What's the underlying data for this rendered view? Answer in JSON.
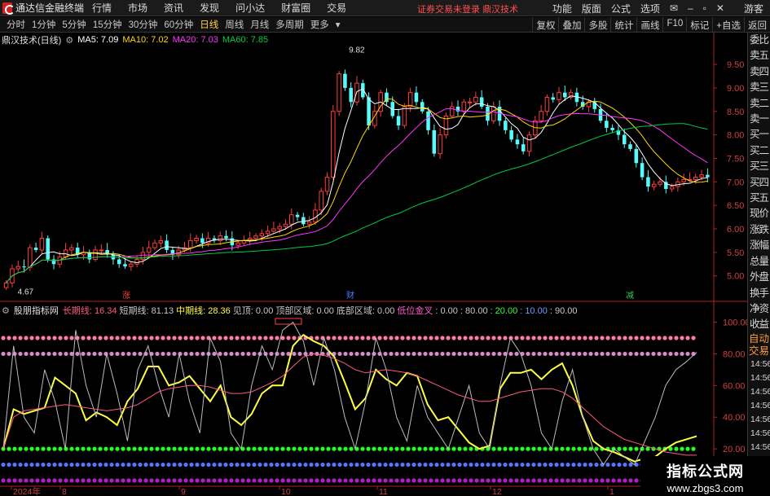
{
  "app": {
    "title": "通达信金融终端"
  },
  "menu": {
    "items": [
      "行情",
      "市场",
      "资讯",
      "发现",
      "问小达",
      "财富圈",
      "交易"
    ],
    "notice_warn": "证券交易未登录",
    "notice_stock": "鼎汉技术",
    "right_items": [
      "功能",
      "版面",
      "公式",
      "选项"
    ],
    "guest": "游客"
  },
  "toolbar": {
    "periods": [
      "分时",
      "1分钟",
      "5分钟",
      "15分钟",
      "30分钟",
      "60分钟",
      "日线",
      "周线",
      "月线",
      "多周期",
      "更多"
    ],
    "active_period": "日线",
    "tools": [
      "复权",
      "叠加",
      "多股",
      "统计",
      "画线",
      "F10",
      "标记",
      "+自选",
      "返回"
    ]
  },
  "main_indicator": {
    "stock_label": "鼎汉技术(日线)",
    "ma5": "MA5: 7.09",
    "ma10": "MA10: 7.02",
    "ma20": "MA20: 7.03",
    "ma60": "MA60: 7.85",
    "colors": {
      "ma5": "#ffffff",
      "ma10": "#ffd700",
      "ma20": "#ff33ff",
      "ma60": "#00cc44"
    }
  },
  "sub_indicator": {
    "name": "股朋指标网",
    "items": [
      {
        "text": "长期线: 16.34",
        "color": "#ff5a7a"
      },
      {
        "text": "短期线: 81.13",
        "color": "#c8c8c8"
      },
      {
        "text": "中期线: 28.36",
        "color": "#ffff44"
      },
      {
        "text": "见顶: 0.00",
        "color": "#c8c8c8"
      },
      {
        "text": "顶部区域: 0.00",
        "color": "#c8c8c8"
      },
      {
        "text": "底部区域: 0.00",
        "color": "#c8c8c8"
      },
      {
        "text": "低位金叉",
        "color": "#ff55cc"
      },
      {
        "text": ": 0.00",
        "color": "#c8c8c8"
      },
      {
        "text": ": 80.00",
        "color": "#c8c8c8"
      },
      {
        "text": ": 20.00",
        "color": "#33ff33"
      },
      {
        "text": ": 10.00",
        "color": "#6f9bff"
      },
      {
        "text": ": 90.00",
        "color": "#c8c8c8"
      }
    ]
  },
  "side_labels": {
    "top": [
      "委比",
      "卖五",
      "卖四",
      "卖三",
      "卖二",
      "卖一",
      "买一",
      "买二",
      "买三",
      "买四",
      "买五",
      "现价",
      "涨跌",
      "涨幅",
      "总量",
      "外盘",
      "换手",
      "净资",
      "收益"
    ],
    "orange": [
      "自动",
      "交易"
    ],
    "times": [
      "14:56",
      "14:56",
      "14:56",
      "14:56",
      "14:56",
      "14:56",
      "14:56",
      "14:56",
      "14:56",
      "14:56"
    ]
  },
  "watermark": {
    "line1": "指标公式网",
    "line2": "www.zbgs3.com"
  },
  "chart_data": [
    {
      "type": "candlestick",
      "title": "鼎汉技术(日线)",
      "ylim": [
        4.7,
        9.9
      ],
      "y_ticks": [
        5.0,
        5.5,
        6.0,
        6.5,
        7.0,
        7.5,
        8.0,
        8.5,
        9.0,
        9.5
      ],
      "annotations": [
        {
          "text": "9.82"
        },
        {
          "text": "4.67"
        }
      ],
      "event_markers": [
        {
          "text": "涨",
          "color": "#ff4040"
        },
        {
          "text": "财",
          "color": "#4a7dff"
        },
        {
          "text": "减",
          "color": "#33cc55"
        }
      ],
      "x_labels": [
        "2024年",
        "8",
        "9",
        "10",
        "11",
        "12",
        "1"
      ],
      "closes": [
        4.85,
        5.15,
        5.2,
        5.18,
        5.6,
        5.55,
        5.8,
        5.35,
        5.25,
        5.4,
        5.55,
        5.6,
        5.45,
        5.5,
        5.35,
        5.55,
        5.55,
        5.45,
        5.35,
        5.25,
        5.2,
        5.25,
        5.35,
        5.5,
        5.6,
        5.7,
        5.75,
        5.55,
        5.45,
        5.55,
        5.6,
        5.75,
        5.8,
        5.7,
        5.8,
        5.75,
        5.85,
        5.8,
        5.65,
        5.7,
        5.75,
        5.8,
        5.85,
        5.9,
        5.95,
        6.0,
        6.05,
        6.1,
        6.3,
        6.25,
        6.1,
        6.15,
        6.4,
        6.8,
        7.1,
        8.5,
        9.3,
        9.0,
        8.7,
        9.1,
        8.8,
        8.2,
        8.5,
        8.9,
        8.7,
        8.4,
        8.2,
        8.6,
        8.9,
        8.7,
        8.5,
        8.1,
        7.6,
        8.0,
        8.4,
        8.6,
        8.5,
        8.7,
        8.7,
        8.8,
        8.6,
        8.3,
        8.6,
        8.3,
        8.1,
        7.9,
        7.8,
        7.65,
        8.0,
        8.3,
        8.5,
        8.8,
        8.75,
        8.9,
        8.8,
        8.9,
        8.7,
        8.6,
        8.7,
        8.55,
        8.3,
        8.15,
        8.1,
        8.0,
        7.8,
        7.7,
        7.4,
        7.1,
        6.9,
        6.95,
        7.0,
        6.85,
        6.9,
        7.0,
        7.05,
        7.05,
        7.1,
        7.15,
        7.1
      ],
      "series": [
        {
          "name": "MA5",
          "color": "#ffffff"
        },
        {
          "name": "MA10",
          "color": "#ffd700"
        },
        {
          "name": "MA20",
          "color": "#ff33ff"
        },
        {
          "name": "MA60",
          "color": "#00cc44"
        }
      ]
    },
    {
      "type": "line",
      "title": "股朋指标网",
      "ylim": [
        0,
        108
      ],
      "y_ticks": [
        20.0,
        40.0,
        60.0,
        80.0,
        100.0
      ],
      "series": [
        {
          "name": "中期线",
          "color": "#ffff44",
          "values": [
            20,
            45,
            42,
            44,
            46,
            65,
            60,
            55,
            38,
            43,
            40,
            35,
            50,
            58,
            72,
            72,
            60,
            62,
            66,
            58,
            50,
            60,
            40,
            35,
            42,
            55,
            60,
            60,
            85,
            92,
            88,
            85,
            78,
            62,
            45,
            52,
            70,
            64,
            60,
            68,
            66,
            48,
            38,
            40,
            32,
            24,
            20,
            22,
            58,
            68,
            68,
            70,
            64,
            70,
            74,
            60,
            40,
            25,
            20,
            18,
            15,
            12,
            14,
            15,
            20,
            24,
            26,
            28
          ]
        },
        {
          "name": "短期线",
          "color": "#bbbbbb",
          "values": [
            20,
            85,
            40,
            30,
            70,
            50,
            20,
            95,
            60,
            40,
            80,
            55,
            25,
            70,
            85,
            60,
            40,
            80,
            50,
            30,
            90,
            75,
            30,
            20,
            60,
            85,
            70,
            95,
            100,
            88,
            60,
            90,
            70,
            40,
            20,
            50,
            90,
            70,
            40,
            25,
            60,
            40,
            30,
            20,
            40,
            60,
            30,
            20,
            60,
            90,
            80,
            60,
            30,
            20,
            50,
            70,
            40,
            20,
            10,
            20,
            15,
            10,
            25,
            40,
            60,
            70,
            75,
            81
          ]
        },
        {
          "name": "长期线",
          "color": "#ff5a7a",
          "values": [
            20,
            40,
            44,
            45,
            46,
            47,
            48,
            47,
            46,
            45,
            44,
            45,
            46,
            48,
            52,
            56,
            58,
            59,
            60,
            60,
            59,
            57,
            55,
            55,
            56,
            59,
            62,
            66,
            72,
            78,
            80,
            79,
            77,
            74,
            70,
            68,
            69,
            70,
            69,
            68,
            66,
            63,
            60,
            57,
            54,
            52,
            50,
            50,
            52,
            54,
            56,
            57,
            58,
            58,
            56,
            52,
            46,
            40,
            34,
            30,
            26,
            24,
            22,
            20,
            18,
            17,
            16,
            16
          ]
        }
      ],
      "dotted_levels": [
        {
          "value": 90,
          "color": "#ff7aa8"
        },
        {
          "value": 80,
          "color": "#d88ac8"
        },
        {
          "value": 20,
          "color": "#22ff22"
        },
        {
          "value": 10,
          "color": "#5577ff"
        },
        {
          "value": 0,
          "color": "#b020c8"
        }
      ]
    }
  ]
}
